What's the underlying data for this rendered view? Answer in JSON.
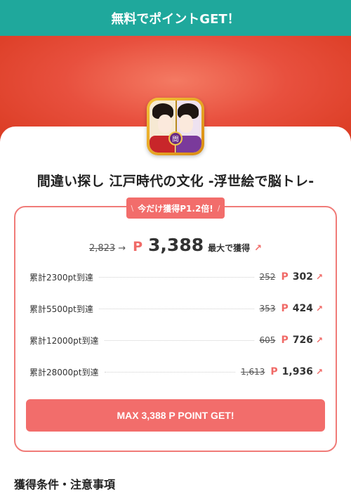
{
  "topbar": {
    "title": "無料でポイントGET！"
  },
  "app": {
    "title": "間違い探し 江戸時代の文化 -浮世絵で脳トレ-",
    "icon_seal_text": "間"
  },
  "badge": {
    "text": "今だけ獲得P1.2倍!",
    "deco_left": "\\",
    "deco_right": "/"
  },
  "max": {
    "old": "2,823",
    "arrow": "→",
    "p": "P",
    "value": "3,388",
    "label": "最大で獲得",
    "up": "↗"
  },
  "tiers": [
    {
      "label": "累計2300pt到達",
      "old": "252",
      "p": "P",
      "value": "302",
      "up": "↗"
    },
    {
      "label": "累計5500pt到達",
      "old": "353",
      "p": "P",
      "value": "424",
      "up": "↗"
    },
    {
      "label": "累計12000pt到達",
      "old": "605",
      "p": "P",
      "value": "726",
      "up": "↗"
    },
    {
      "label": "累計28000pt到達",
      "old": "1,613",
      "p": "P",
      "value": "1,936",
      "up": "↗"
    }
  ],
  "cta": {
    "label": "MAX 3,388 P POINT GET!"
  },
  "conditions": {
    "heading": "獲得条件・注意事項"
  },
  "colors": {
    "teal": "#1fa89c",
    "accent": "#f26d6b",
    "hero": "#e8503e"
  }
}
